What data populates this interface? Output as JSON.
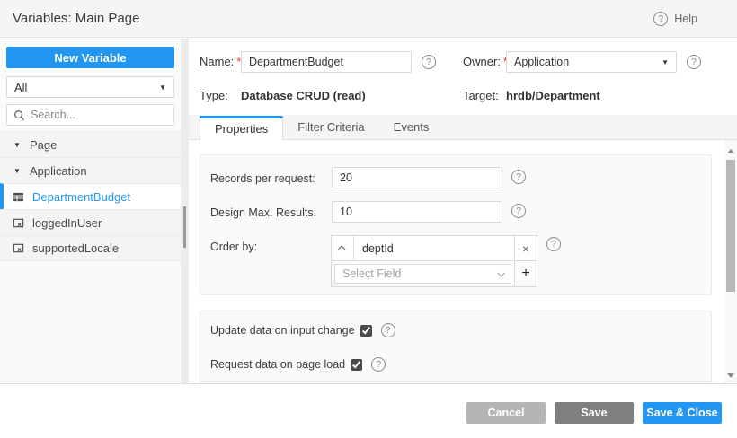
{
  "header": {
    "title": "Variables: Main Page",
    "help_label": "Help"
  },
  "sidebar": {
    "new_variable_label": "New Variable",
    "filter_value": "All",
    "search_placeholder": "Search...",
    "tree": [
      {
        "label": "Page",
        "type": "group",
        "expanded": true
      },
      {
        "label": "Application",
        "type": "group",
        "expanded": true
      },
      {
        "label": "DepartmentBudget",
        "type": "crud-variable",
        "selected": true
      },
      {
        "label": "loggedInUser",
        "type": "static-variable",
        "selected": false
      },
      {
        "label": "supportedLocale",
        "type": "static-variable",
        "selected": false
      }
    ]
  },
  "details": {
    "name_label": "Name:",
    "required_mark": "*",
    "name_value": "DepartmentBudget",
    "owner_label": "Owner:",
    "owner_value": "Application",
    "type_label": "Type:",
    "type_value": "Database CRUD (read)",
    "target_label": "Target:",
    "target_value": "hrdb/Department"
  },
  "tabs": [
    {
      "label": "Properties",
      "active": true
    },
    {
      "label": "Filter Criteria",
      "active": false
    },
    {
      "label": "Events",
      "active": false
    }
  ],
  "properties_form": {
    "records_per_request": {
      "label": "Records per request:",
      "value": "20"
    },
    "design_max_results": {
      "label": "Design Max. Results:",
      "value": "10"
    },
    "order_by": {
      "label": "Order by:",
      "field_value": "deptId",
      "sort_direction": "ascending",
      "select_placeholder": "Select Field"
    },
    "update_on_input": {
      "label": "Update data on input change",
      "checked": true
    },
    "request_on_load": {
      "label": "Request data on page load",
      "checked": true
    }
  },
  "footer": {
    "cancel_label": "Cancel",
    "save_label": "Save",
    "save_close_label": "Save & Close"
  },
  "icons": {
    "question": "?",
    "caret_down": "▼",
    "select_arrow": "▼",
    "close": "×",
    "add": "+"
  },
  "colors": {
    "accent": "#2196f3",
    "save_button": "#7f7f7f",
    "cancel_button": "#b5b5b5"
  }
}
